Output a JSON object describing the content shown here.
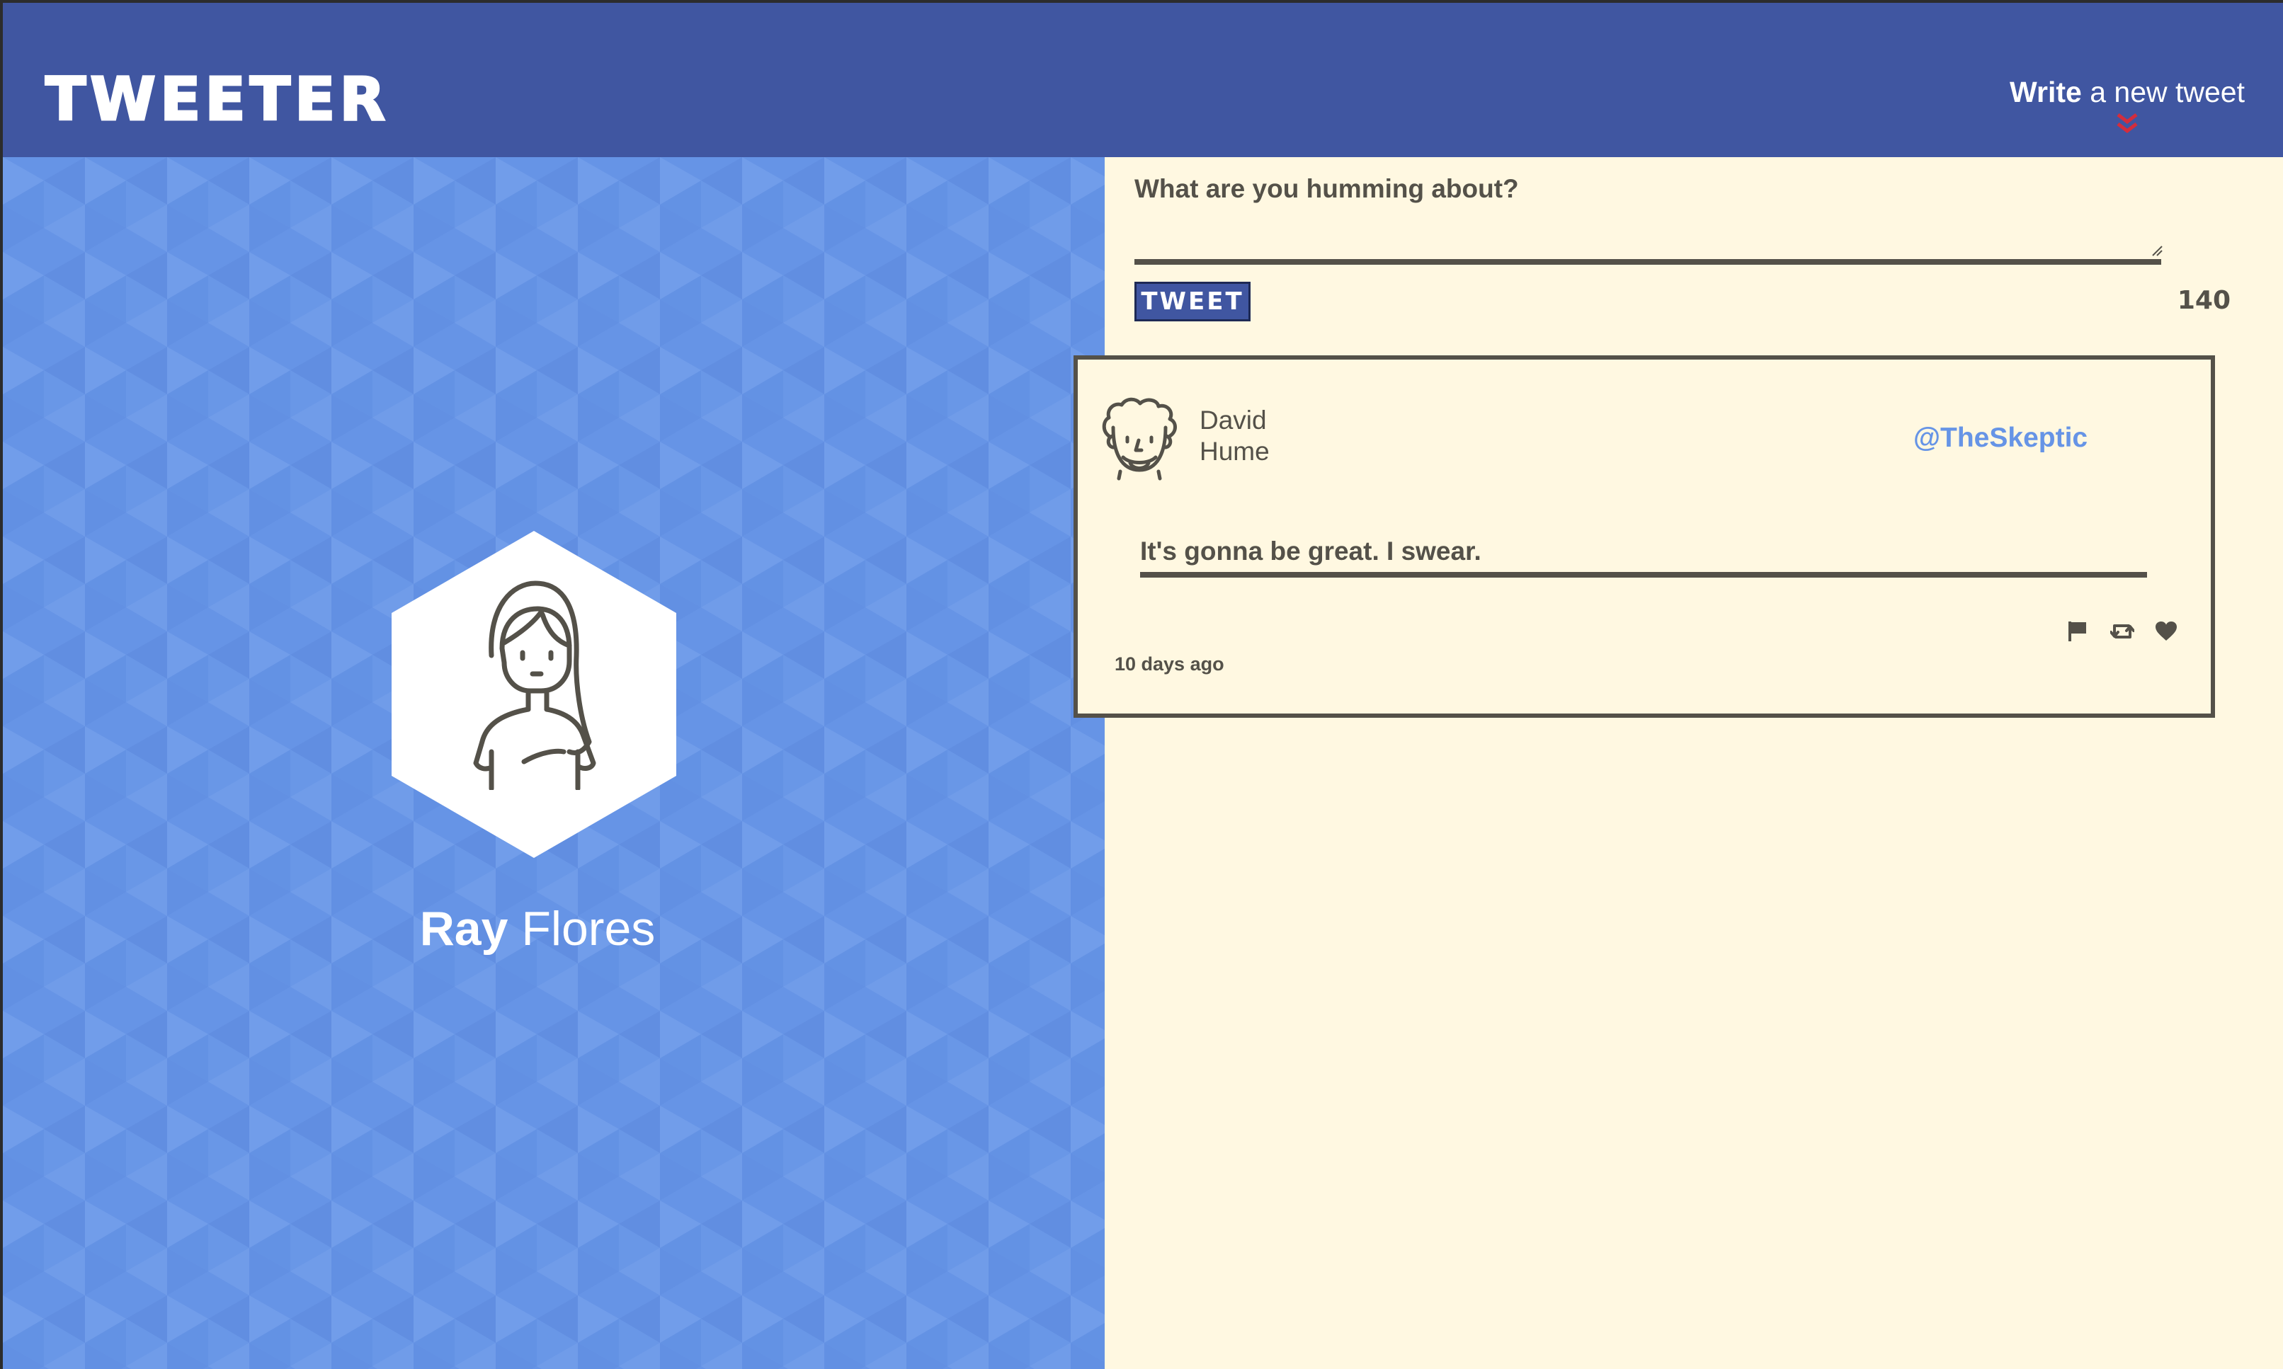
{
  "app": {
    "logo": "TWEETER"
  },
  "nav": {
    "compose_bold": "Write",
    "compose_rest": " a new tweet",
    "compose_icon": "double-chevron-down-icon"
  },
  "profile": {
    "first_name": "Ray",
    "last_name": " Flores",
    "avatar_icon": "user-avatar-icon"
  },
  "composer": {
    "label": "What are you humming about?",
    "value": "",
    "placeholder": "",
    "button_label": "TWEET",
    "char_count": "140"
  },
  "tweets": [
    {
      "author_first": "David",
      "author_last": "Hume",
      "handle": "@TheSkeptic",
      "content": "It's gonna be great. I swear.",
      "timestamp": "10 days ago",
      "avatar_icon": "philosopher-avatar-icon",
      "actions": [
        "flag-icon",
        "retweet-icon",
        "heart-icon"
      ]
    }
  ],
  "colors": {
    "nav": "#4056a1",
    "profile_bg": "#6694e6",
    "main_bg": "#fff8e1",
    "text": "#545149",
    "accent_red": "#d32d3d",
    "handle": "#6694e6"
  }
}
